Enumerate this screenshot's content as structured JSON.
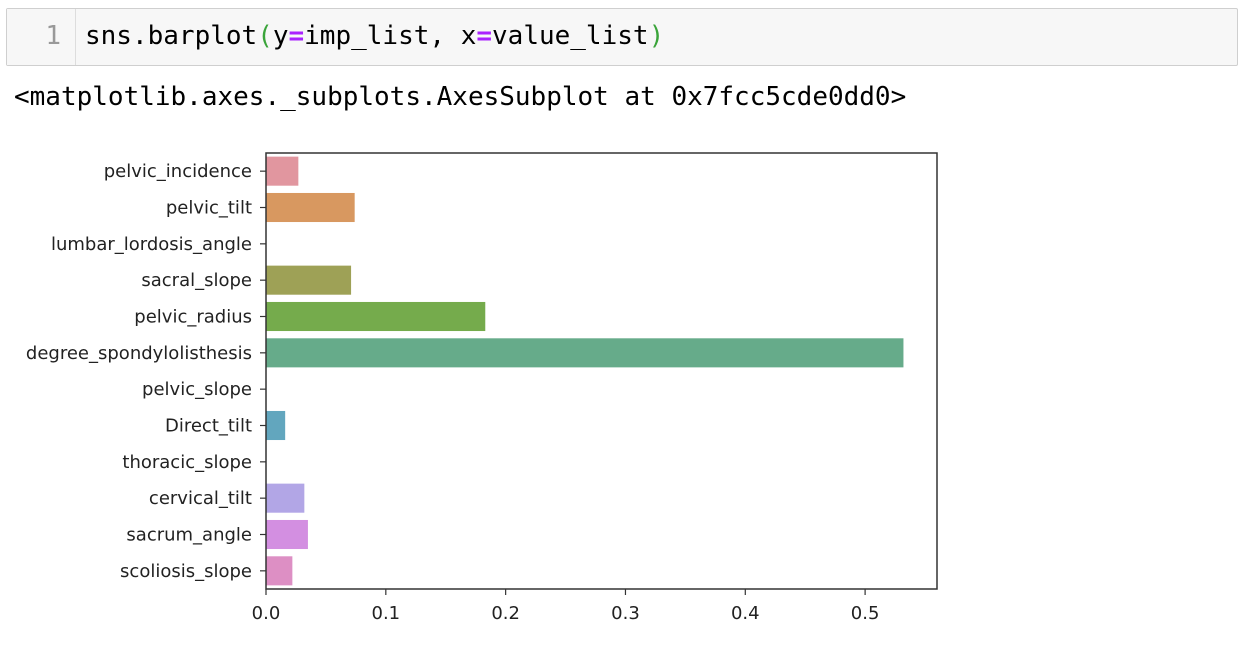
{
  "input_cell": {
    "line_number": "1",
    "code_fn": "sns.barplot",
    "code_open_paren": "(",
    "code_arg1_name": "y",
    "code_eq1": "=",
    "code_arg1_value": "imp_list, ",
    "code_arg2_name": "x",
    "code_eq2": "=",
    "code_arg2_value": "value_list",
    "code_close_paren": ")"
  },
  "output_cell": {
    "repr_text": "<matplotlib.axes._subplots.AxesSubplot at 0x7fcc5cde0dd0>"
  },
  "chart_data": {
    "type": "bar",
    "orientation": "horizontal",
    "categories": [
      "pelvic_incidence",
      "pelvic_tilt",
      "lumbar_lordosis_angle",
      "sacral_slope",
      "pelvic_radius",
      "degree_spondylolisthesis",
      "pelvic_slope",
      "Direct_tilt",
      "thoracic_slope",
      "cervical_tilt",
      "sacrum_angle",
      "scoliosis_slope"
    ],
    "values": [
      0.027,
      0.074,
      0.0,
      0.071,
      0.183,
      0.532,
      0.0,
      0.016,
      0.0,
      0.032,
      0.035,
      0.022
    ],
    "colors": [
      "#e1969f",
      "#d89860",
      "#bca054",
      "#9ea156",
      "#75ab4c",
      "#66ab8a",
      "#61aaa1",
      "#62a6be",
      "#88a4de",
      "#b2a6e6",
      "#d38fe1",
      "#dd8fc4"
    ],
    "xlim": [
      0,
      0.56
    ],
    "xticks": [
      "0.0",
      "0.1",
      "0.2",
      "0.3",
      "0.4",
      "0.5"
    ],
    "title": "",
    "xlabel": "",
    "ylabel": "",
    "grid": false,
    "legend": "none"
  }
}
